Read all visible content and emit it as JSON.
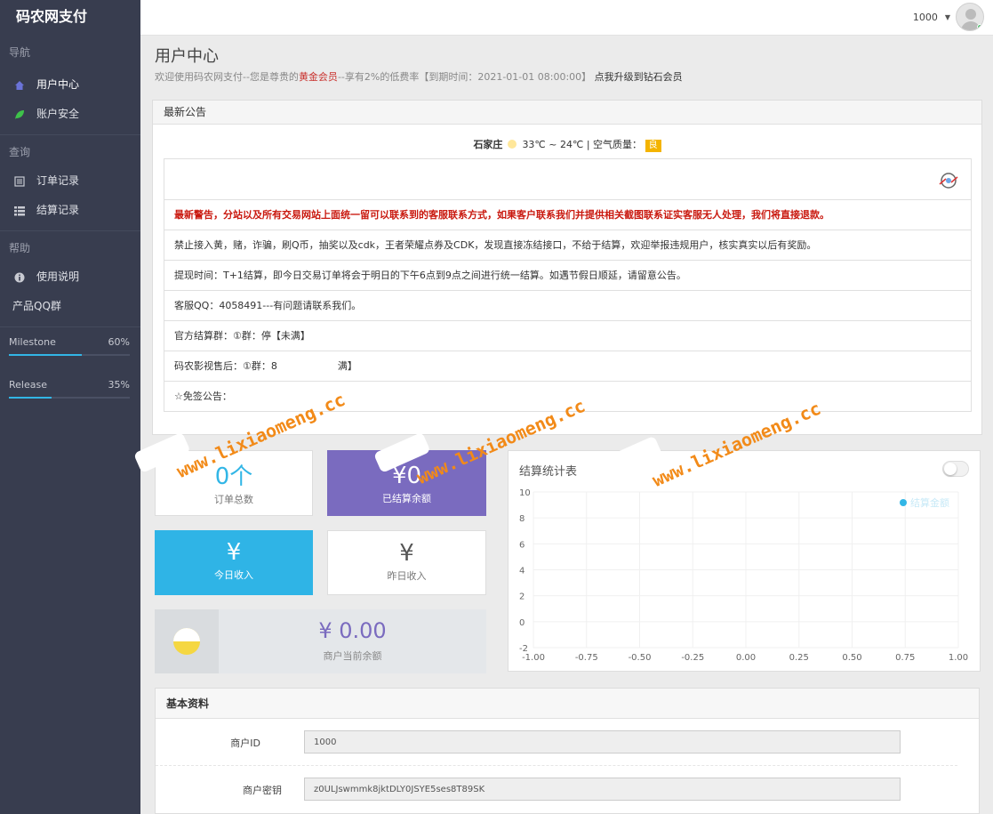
{
  "sidebar": {
    "brand": "码农网支付",
    "sections": [
      {
        "title": "导航",
        "items": [
          {
            "label": "用户中心",
            "icon": "home-icon"
          },
          {
            "label": "账户安全",
            "icon": "leaf-icon"
          }
        ]
      },
      {
        "title": "查询",
        "items": [
          {
            "label": "订单记录",
            "icon": "list-icon"
          },
          {
            "label": "结算记录",
            "icon": "table-icon"
          }
        ]
      },
      {
        "title": "帮助",
        "items": [
          {
            "label": "使用说明",
            "icon": "info-icon"
          },
          {
            "label": "产品QQ群",
            "icon": ""
          }
        ]
      }
    ],
    "progress": [
      {
        "label": "Milestone",
        "percent_text": "60%",
        "value": 0.6
      },
      {
        "label": "Release",
        "percent_text": "35%",
        "value": 0.35
      }
    ]
  },
  "header": {
    "user_id": "1000"
  },
  "page": {
    "title": "用户中心",
    "sub_1": "欢迎使用码农网支付--您是尊贵的",
    "sub_level": "黄金会员",
    "sub_2": "--享有2%的低费率【到期时间：2021-01-01 08:00:00】",
    "sub_upgrade": "点我升级到钻石会员"
  },
  "notice": {
    "title": "最新公告",
    "weather": {
      "city": "石家庄",
      "temp": "33℃ ~ 24℃ | 空气质量：",
      "aqi": "良"
    },
    "rows": [
      "最新警告，分站以及所有交易网站上面统一留可以联系到的客服联系方式，如果客户联系我们并提供相关截图联系证实客服无人处理，我们将直接退款。",
      "禁止接入黄，赌，诈骗，刷Q币，抽奖以及cdk，王者荣耀点券及CDK，发现直接冻结接口，不给于结算，欢迎举报违规用户，核实真实以后有奖励。",
      "提现时间：T+1结算，即今日交易订单将会于明日的下午6点到9点之间进行统一结算。如遇节假日顺延，请留意公告。",
      "客服QQ：4058491---有问题请联系我们。",
      "官方结算群：①群：停【未满】",
      "码农影视售后：①群：8",
      "☆免签公告："
    ],
    "row6_tail": "满】"
  },
  "stats": {
    "order_count": "0个",
    "order_label": "订单总数",
    "settled_value": "¥0",
    "settled_label": "已结算余额",
    "today_value": "¥",
    "today_label": "今日收入",
    "yesterday_value": "¥",
    "yesterday_label": "昨日收入",
    "balance_value": "¥ 0.00",
    "balance_label": "商户当前余额"
  },
  "chart_data": {
    "type": "line",
    "title": "结算统计表",
    "series": [
      {
        "name": "结算金额",
        "values": []
      }
    ],
    "xlim": [
      -1,
      1
    ],
    "ylim": [
      -2,
      10
    ],
    "x_ticks": [
      "-1.00",
      "-0.75",
      "-0.50",
      "-0.25",
      "0.00",
      "0.25",
      "0.50",
      "0.75",
      "1.00"
    ],
    "y_ticks": [
      "10",
      "8",
      "6",
      "4",
      "2",
      "0",
      "-2"
    ],
    "legend_position": "top-right",
    "grid": true,
    "series_color": "#32b6e6"
  },
  "basic": {
    "title": "基本资料",
    "fields": [
      {
        "label": "商户ID",
        "value": "1000"
      },
      {
        "label": "商户密钥",
        "value": "z0ULJswmmk8jktDLY0JSYE5ses8T89SK"
      }
    ]
  },
  "watermark": "www.lixiaomeng.cc",
  "colors": {
    "sidebar": "#383d4f",
    "accent": "#32b6e6",
    "purple": "#7a6bbf",
    "warning": "#c9180e",
    "watermark": "#f28a18"
  }
}
